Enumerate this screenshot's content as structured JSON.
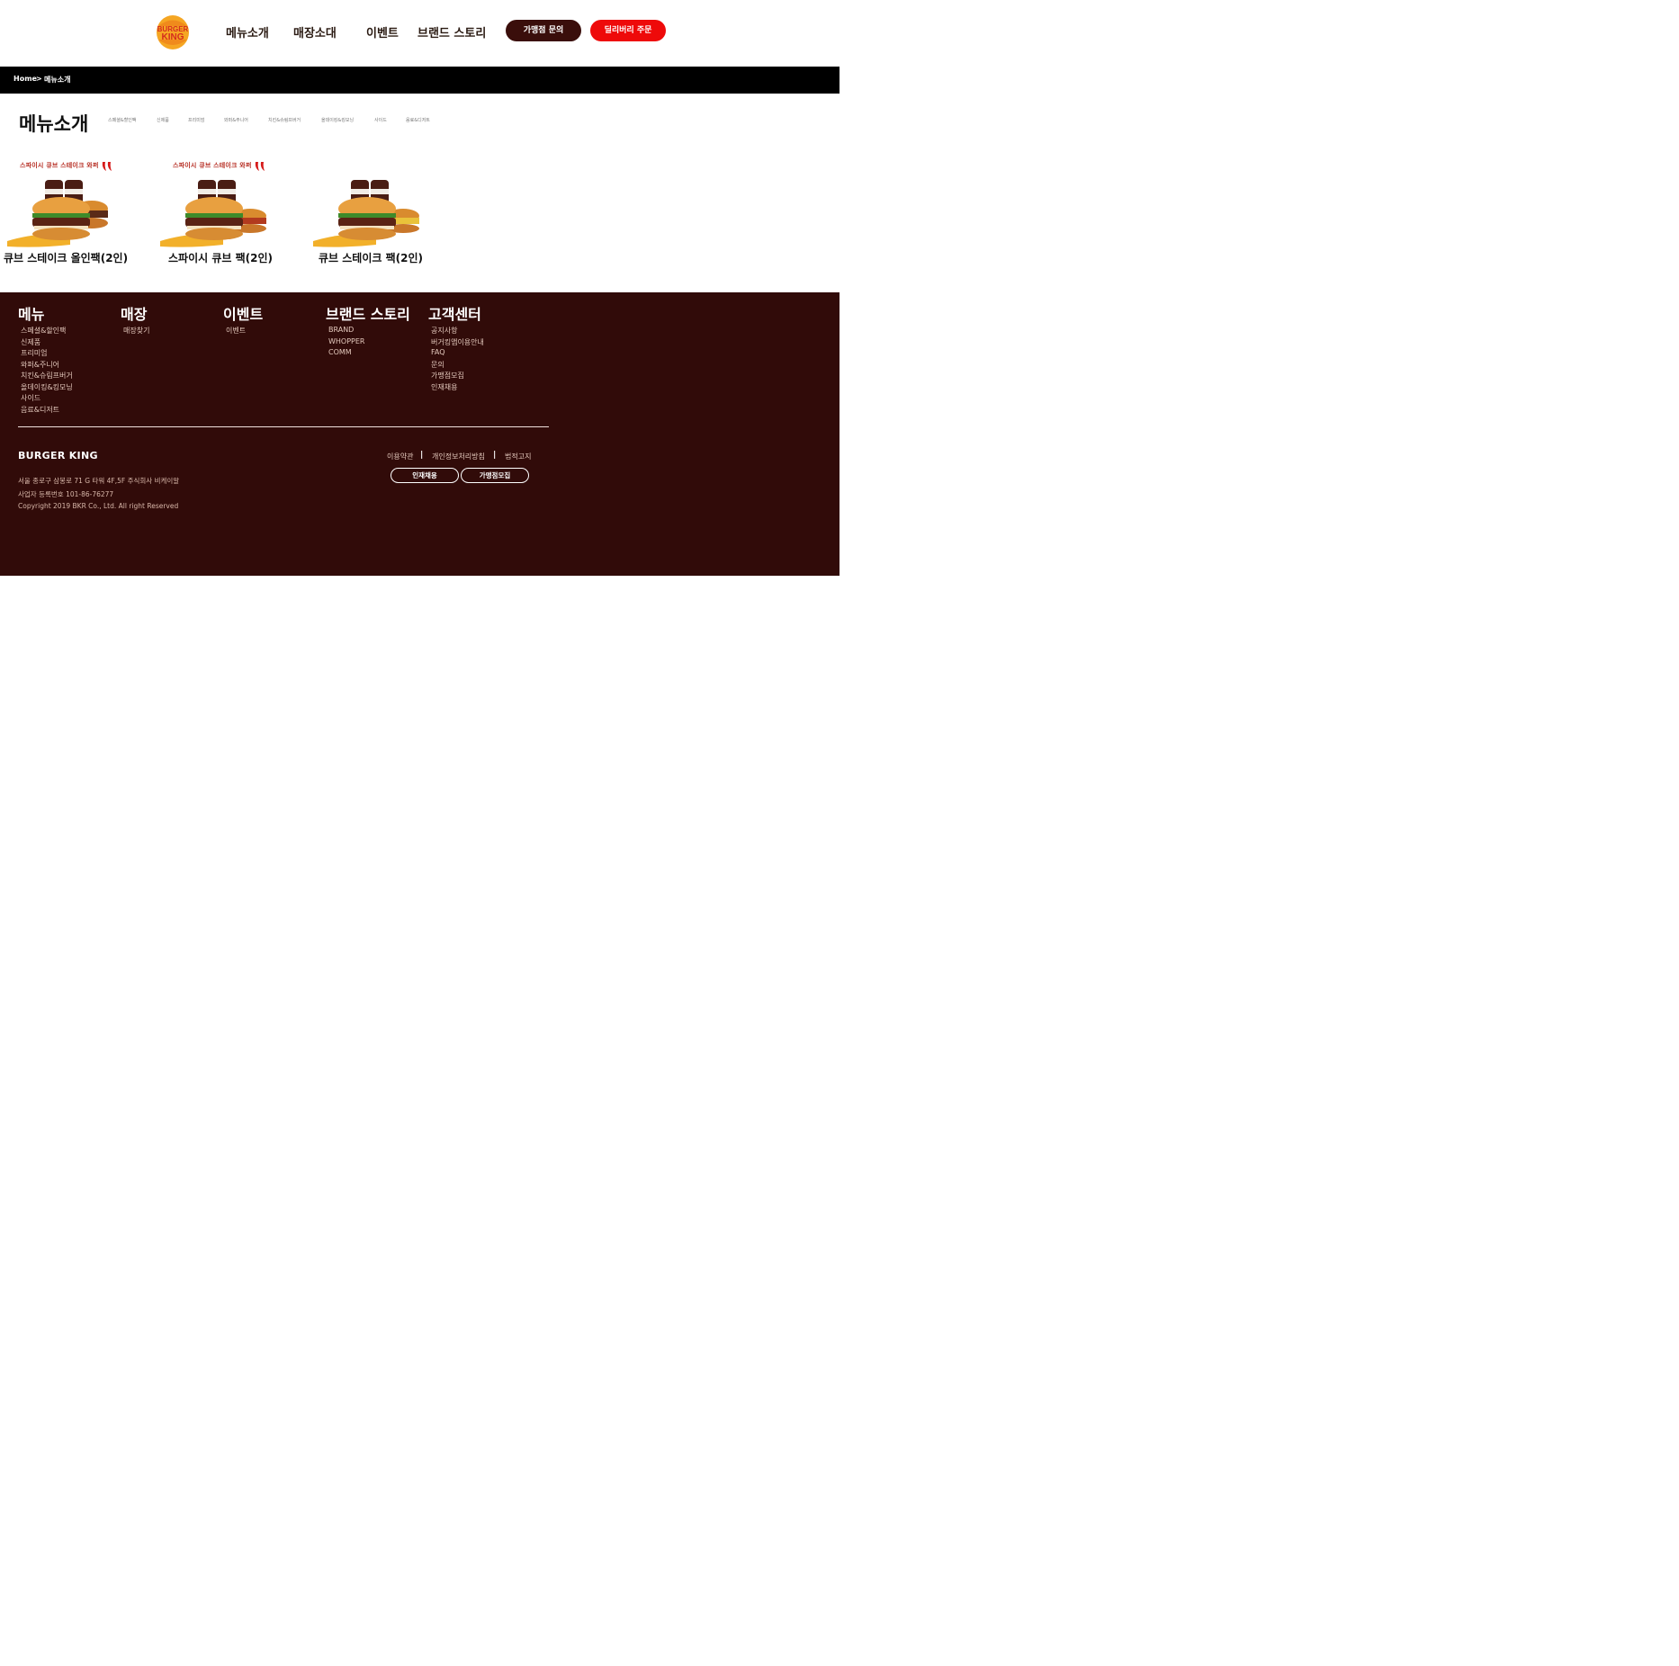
{
  "header": {
    "logo_text_top": "BURGER",
    "logo_text_bottom": "KING",
    "nav": [
      "메뉴소개",
      "매장소대",
      "이벤트",
      "브랜드 스토리"
    ],
    "franchise_button": "가맹점 문의",
    "delivery_button": "딜리버리 주문",
    "colors": {
      "dark": "#3a0e0b",
      "red": "#ee0a0a"
    }
  },
  "breadcrumb": {
    "home": "Home",
    "separator": ">",
    "current": "메뉴소개"
  },
  "page": {
    "title": "메뉴소개",
    "subtabs": [
      "스페셜&할인팩",
      "신제품",
      "프리미엄",
      "와퍼&주니어",
      "치킨&슈림프버거",
      "올데이킹&킹모닝",
      "사이드",
      "음료&디저트"
    ]
  },
  "products": [
    {
      "banner": "스파이시 큐브 스테이크 와퍼",
      "name": "큐브 스테이크 올인팩(2인)",
      "icon": "chili-pepper-icon"
    },
    {
      "banner": "스파이시 큐브 스테이크 와퍼",
      "name": "스파이시 큐브 팩(2인)",
      "icon": "chili-pepper-icon"
    },
    {
      "banner": "",
      "name": "큐브 스테이크 팩(2인)",
      "icon": ""
    }
  ],
  "footer": {
    "columns": [
      {
        "title": "메뉴",
        "links": [
          "스페셜&할인팩",
          "신제품",
          "프리미엄",
          "와퍼&주니어",
          "치킨&슈림프버거",
          "올데이킹&킹모닝",
          "사이드",
          "음료&디저트"
        ]
      },
      {
        "title": "매장",
        "links": [
          "매장찾기"
        ]
      },
      {
        "title": "이벤트",
        "links": [
          "이벤트"
        ]
      },
      {
        "title": "브랜드 스토리",
        "links": [
          "BRAND",
          "WHOPPER",
          "COMM"
        ]
      },
      {
        "title": "고객센터",
        "links": [
          "공지사항",
          "버거킹앱이용안내",
          "FAQ",
          "문의",
          "가맹점모집",
          "인재채용"
        ]
      }
    ],
    "brand": "BURGER KING",
    "address": "서울 종로구 삼봉로 71 G 타워 4F,5F 주식회사 비케이알",
    "business_number": "사업자 등록번호 101-86-76277",
    "copyright": "Copyright 2019 BKR Co., Ltd. All right Reserved",
    "legal_links": [
      "이용약관",
      "개인정보처리방침",
      "법적고지"
    ],
    "buttons": [
      "인재채용",
      "가맹점모집"
    ],
    "background": "#310b09"
  }
}
